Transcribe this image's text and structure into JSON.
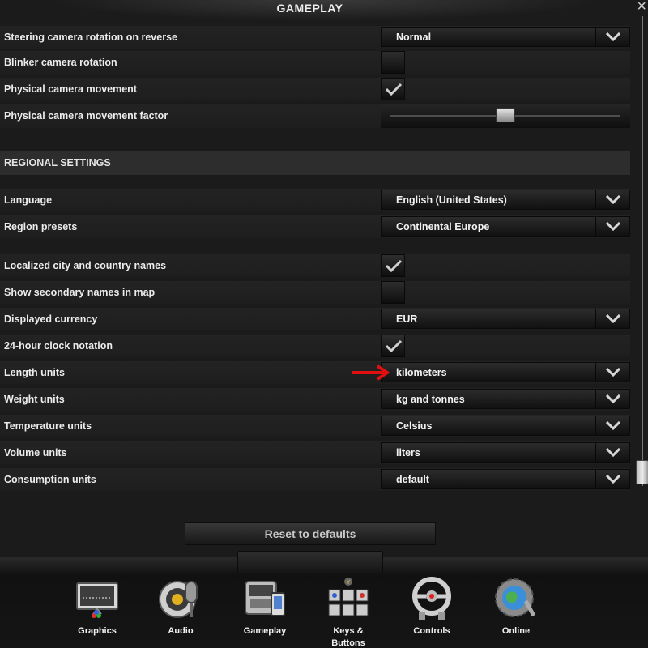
{
  "window": {
    "title": "GAMEPLAY",
    "close_glyph": "×"
  },
  "rows": [
    {
      "label": "Steering camera rotation on reverse",
      "type": "dropdown",
      "value": "Normal"
    },
    {
      "label": "Blinker camera rotation",
      "type": "checkbox",
      "checked": false
    },
    {
      "label": "Physical camera movement",
      "type": "checkbox",
      "checked": true
    },
    {
      "label": "Physical camera movement factor",
      "type": "slider",
      "level": 0.5
    }
  ],
  "regional": {
    "section_title": "REGIONAL SETTINGS",
    "rows": [
      {
        "label": "Language",
        "type": "dropdown",
        "value": "English (United States)"
      },
      {
        "label": "Region presets",
        "type": "dropdown",
        "value": "Continental Europe"
      },
      {
        "label": "Localized city and country names",
        "type": "checkbox",
        "checked": true
      },
      {
        "label": "Show secondary names in map",
        "type": "checkbox",
        "checked": false
      },
      {
        "label": "Displayed currency",
        "type": "dropdown",
        "value": "EUR"
      },
      {
        "label": "24-hour clock notation",
        "type": "checkbox",
        "checked": true
      },
      {
        "label": "Length units",
        "type": "dropdown",
        "value": "kilometers"
      },
      {
        "label": "Weight units",
        "type": "dropdown",
        "value": "kg and tonnes"
      },
      {
        "label": "Temperature units",
        "type": "dropdown",
        "value": "Celsius"
      },
      {
        "label": "Volume units",
        "type": "dropdown",
        "value": "liters"
      },
      {
        "label": "Consumption units",
        "type": "dropdown",
        "value": "default"
      }
    ]
  },
  "reset_button": "Reset to defaults",
  "annotation": {
    "icon": "red-arrow-icon",
    "color": "#e01010"
  },
  "colors": {
    "background": "#1b1b1b",
    "row": "#222222",
    "section": "#2d2d2d",
    "text": "#ececec"
  },
  "nav": [
    {
      "label": "Graphics",
      "icon": "monitor-icon"
    },
    {
      "label": "Audio",
      "icon": "speaker-microphone-icon"
    },
    {
      "label": "Gameplay",
      "icon": "truck-phone-icon"
    },
    {
      "label": "Keys & Buttons",
      "icon": "keyboard-keys-icon"
    },
    {
      "label": "Controls",
      "icon": "steering-wheel-icon"
    },
    {
      "label": "Online",
      "icon": "globe-gear-icon"
    }
  ]
}
